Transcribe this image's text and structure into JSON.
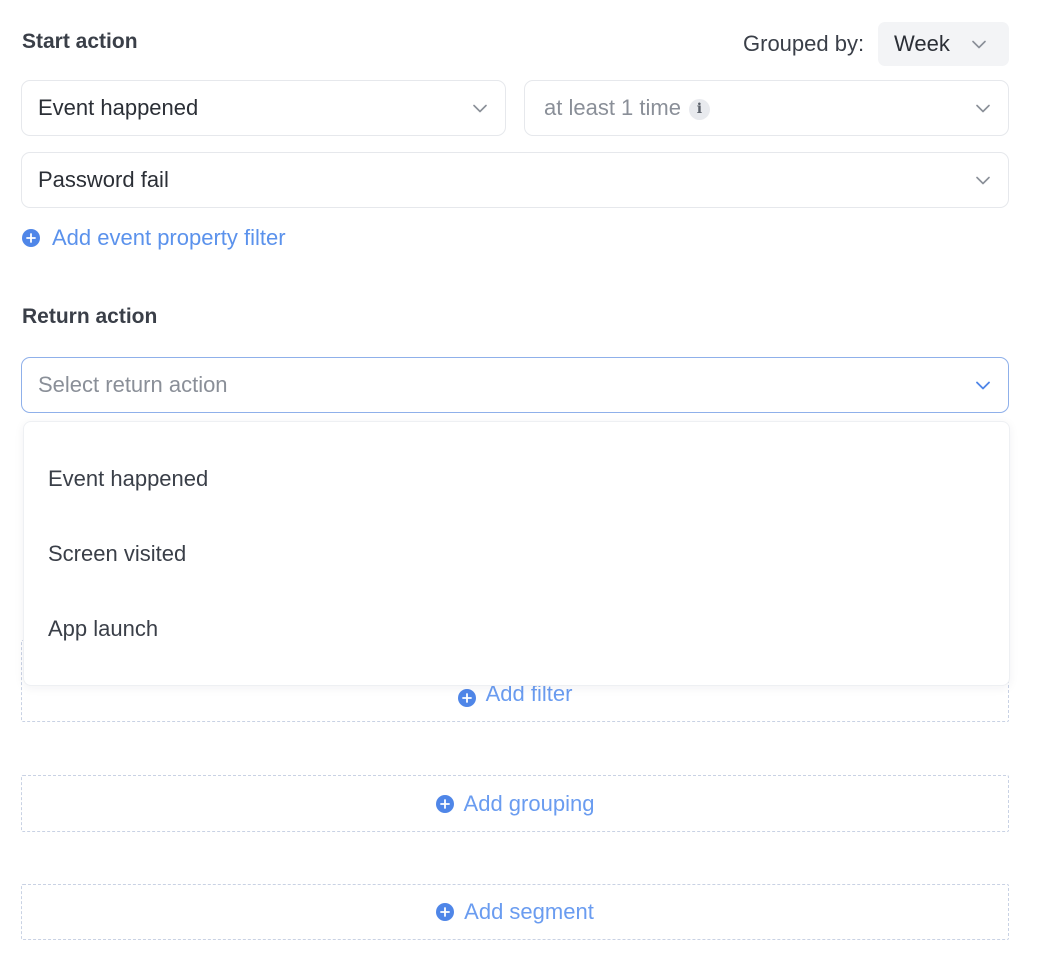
{
  "start_action": {
    "title": "Start action",
    "grouped_by_label": "Grouped by:",
    "grouped_by_value": "Week",
    "event_type": "Event happened",
    "frequency": "at least 1 time",
    "event_name": "Password fail",
    "add_filter_label": "Add event property filter"
  },
  "return_action": {
    "title": "Return action",
    "placeholder": "Select return action",
    "options": [
      "Event happened",
      "Screen visited",
      "App launch"
    ]
  },
  "buttons": {
    "add_filter": "Add filter",
    "add_grouping": "Add grouping",
    "add_segment": "Add segment"
  },
  "colors": {
    "accent": "#4f86e8",
    "link": "#5b92ec",
    "focus_border": "#8fb0ea"
  }
}
